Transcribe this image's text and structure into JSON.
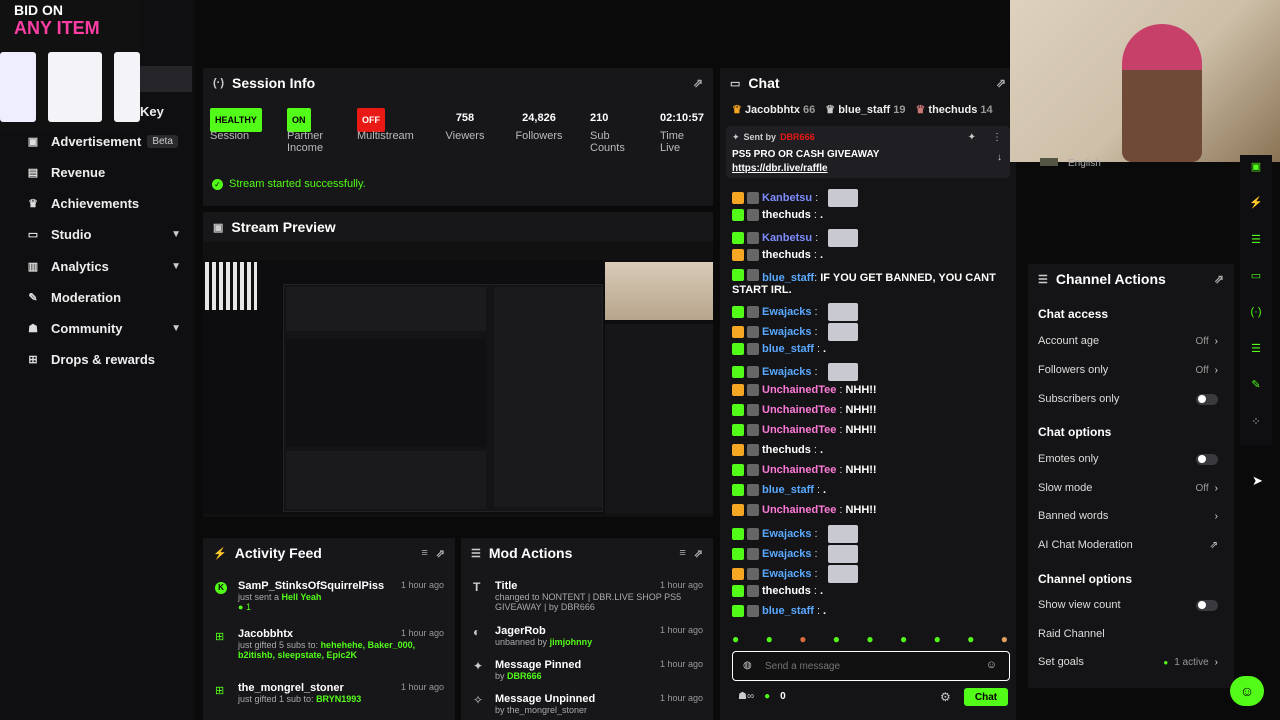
{
  "promo": {
    "line1": "BID ON",
    "line2": "ANY ITEM"
  },
  "sidebar": {
    "partial_key": "Key",
    "advertisement": "Advertisement",
    "beta": "Beta",
    "items": [
      {
        "label": "Revenue",
        "icon": "revenue-icon"
      },
      {
        "label": "Achievements",
        "icon": "trophy-icon"
      },
      {
        "label": "Studio",
        "icon": "studio-icon"
      },
      {
        "label": "Analytics",
        "icon": "chart-icon"
      },
      {
        "label": "Moderation",
        "icon": "wrench-icon"
      },
      {
        "label": "Community",
        "icon": "community-icon"
      },
      {
        "label": "Drops & rewards",
        "icon": "gift-icon"
      }
    ]
  },
  "session": {
    "title": "Session Info",
    "health": "HEALTHY",
    "health_label": "Session",
    "partner": "ON",
    "partner_label": "Partner Income",
    "multistream": "OFF",
    "multistream_label": "Multistream",
    "viewers": "758",
    "viewers_label": "Viewers",
    "followers": "24,826",
    "followers_label": "Followers",
    "subs": "210",
    "subs_label": "Sub Counts",
    "time": "02:10:57",
    "time_label": "Time Live",
    "status": "Stream started successfully."
  },
  "preview": {
    "title": "Stream Preview"
  },
  "activity": {
    "title": "Activity Feed",
    "items": [
      {
        "name": "SamP_StinksOfSquirrelPiss",
        "time": "1 hour ago",
        "sub": "just sent a",
        "extra": "Hell Yeah",
        "count": "1"
      },
      {
        "name": "Jacobbhtx",
        "time": "1 hour ago",
        "sub": "just gifted 5 subs to:",
        "extra": "hehehehe, Baker_000, b2itishb, sleepstate, Epic2K"
      },
      {
        "name": "the_mongrel_stoner",
        "time": "1 hour ago",
        "sub": "just gifted 1 sub to:",
        "extra": "BRYN1993"
      }
    ]
  },
  "mod": {
    "title": "Mod Actions",
    "items": [
      {
        "name": "Title",
        "time": "1 hour ago",
        "sub": "changed to NONTENT | DBR.LIVE SHOP PS5 GIVEAWAY | by DBR666"
      },
      {
        "name": "JagerRob",
        "time": "1 hour ago",
        "sub": "unbanned by",
        "extra": "jimjohnny"
      },
      {
        "name": "Message Pinned",
        "time": "1 hour ago",
        "sub": "by",
        "extra": "DBR666"
      },
      {
        "name": "Message Unpinned",
        "time": "1 hour ago",
        "sub": "by the_mongrel_stoner"
      }
    ]
  },
  "chat": {
    "title": "Chat",
    "top_gifters": [
      {
        "name": "Jacobbhtx",
        "count": "66"
      },
      {
        "name": "blue_staff",
        "count": "19"
      },
      {
        "name": "thechuds",
        "count": "14"
      }
    ],
    "pinned": {
      "sent_by": "Sent by",
      "author": "DBR666",
      "text": "PS5 PRO OR CASH GIVEAWAY",
      "link": "https://dbr.live/raffle"
    },
    "messages": [
      {
        "user": "Kanbetsu",
        "text": "",
        "color": "#7d8cff"
      },
      {
        "user": "thechuds",
        "text": ".",
        "color": "#ffffff"
      },
      {
        "user": "Kanbetsu",
        "text": "",
        "color": "#7d8cff"
      },
      {
        "user": "thechuds",
        "text": ".",
        "color": "#ffffff"
      },
      {
        "user": "blue_staff",
        "text": "IF YOU GET BANNED, YOU CANT START IRL.",
        "color": "#5aa9ff"
      },
      {
        "user": "Ewajacks",
        "text": "",
        "color": "#5aa9ff"
      },
      {
        "user": "Ewajacks",
        "text": "",
        "color": "#5aa9ff"
      },
      {
        "user": "blue_staff",
        "text": ".",
        "color": "#5aa9ff"
      },
      {
        "user": "Ewajacks",
        "text": "",
        "color": "#5aa9ff"
      },
      {
        "user": "UnchainedTee",
        "text": "NHH!!",
        "color": "#ff7ad9"
      },
      {
        "user": "UnchainedTee",
        "text": "NHH!!",
        "color": "#ff7ad9"
      },
      {
        "user": "UnchainedTee",
        "text": "NHH!!",
        "color": "#ff7ad9"
      },
      {
        "user": "thechuds",
        "text": ".",
        "color": "#ffffff"
      },
      {
        "user": "UnchainedTee",
        "text": "NHH!!",
        "color": "#ff7ad9"
      },
      {
        "user": "blue_staff",
        "text": ".",
        "color": "#5aa9ff"
      },
      {
        "user": "UnchainedTee",
        "text": "NHH!!",
        "color": "#ff7ad9"
      },
      {
        "user": "Ewajacks",
        "text": "",
        "color": "#5aa9ff"
      },
      {
        "user": "Ewajacks",
        "text": "",
        "color": "#5aa9ff"
      },
      {
        "user": "Ewajacks",
        "text": "",
        "color": "#5aa9ff"
      },
      {
        "user": "thechuds",
        "text": ".",
        "color": "#ffffff"
      },
      {
        "user": "blue_staff",
        "text": ".",
        "color": "#5aa9ff"
      }
    ],
    "placeholder": "Send a message",
    "points": "0",
    "send": "Chat"
  },
  "channel": {
    "title": "Channel Actions",
    "language": "English",
    "chat_access": "Chat access",
    "account_age": "Account age",
    "account_age_val": "Off",
    "followers_only": "Followers only",
    "followers_only_val": "Off",
    "subscribers_only": "Subscribers only",
    "chat_options": "Chat options",
    "emotes_only": "Emotes only",
    "slow_mode": "Slow mode",
    "slow_mode_val": "Off",
    "banned_words": "Banned words",
    "ai_mod": "AI Chat Moderation",
    "channel_options": "Channel options",
    "show_view_count": "Show view count",
    "raid": "Raid Channel",
    "set_goals": "Set goals",
    "set_goals_val": "1 active"
  },
  "colors": {
    "accent": "#53fc18",
    "danger": "#e91916",
    "panel": "#17171a"
  }
}
